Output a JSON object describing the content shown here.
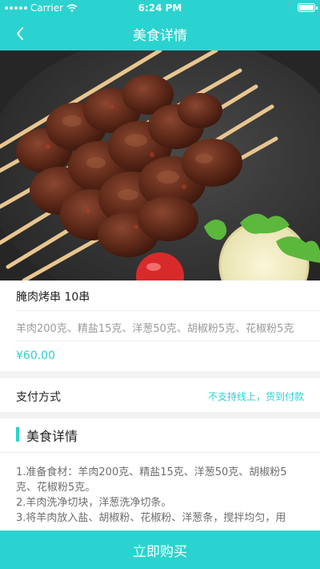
{
  "status_bar": {
    "carrier": "Carrier",
    "time": "6:24 PM",
    "battery_level": 1.0
  },
  "nav": {
    "title": "美食详情",
    "back_icon": "chevron-left-icon"
  },
  "hero_image": {
    "description_icon": "food-photo"
  },
  "dish": {
    "name": "腌肉烤串 10串",
    "ingredients": "羊肉200克、精盐15克、洋葱50克、胡椒粉5克、花椒粉5克",
    "price": "¥60.00"
  },
  "payment": {
    "label": "支付方式",
    "value": "不支持线上，货到付款"
  },
  "details": {
    "heading": "美食详情",
    "steps": [
      "1.准备食材：羊肉200克、精盐15克、洋葱50克、胡椒粉5克、花椒粉5克。",
      "2.羊肉洗净切块，洋葱洗净切条。",
      "3.将羊肉放入盐、胡椒粉、花椒粉、洋葱条，搅拌均匀，用"
    ]
  },
  "buy_button": {
    "label": "立即购买"
  },
  "colors": {
    "accent": "#2ad3cf",
    "text": "#222222",
    "muted": "#9a9a9a"
  }
}
